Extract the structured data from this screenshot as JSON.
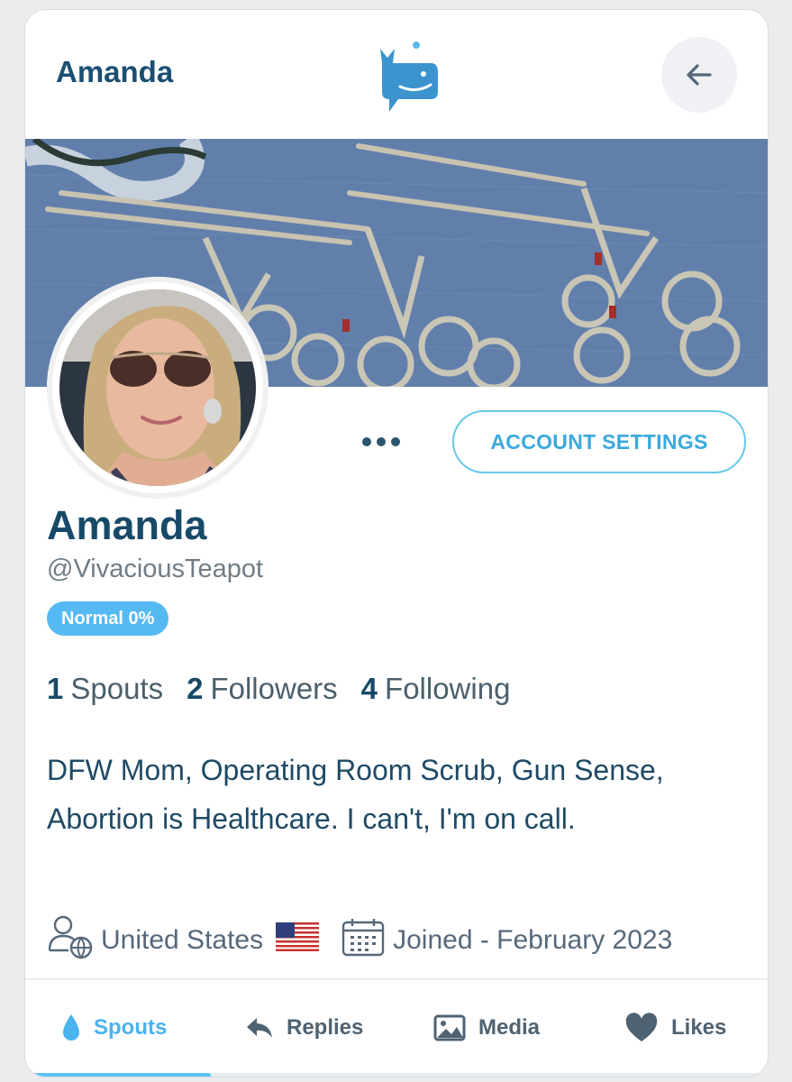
{
  "header": {
    "title": "Amanda",
    "logo_icon": "whale-icon",
    "back_icon": "arrow-left-icon"
  },
  "banner": {
    "description_icon": "surgical-instruments-image"
  },
  "profile": {
    "display_name": "Amanda",
    "handle": "@VivaciousTeapot",
    "badge": "Normal 0%",
    "account_settings_label": "ACCOUNT SETTINGS",
    "more_icon": "more-horizontal-icon"
  },
  "stats": [
    {
      "count": "1",
      "label": "Spouts"
    },
    {
      "count": "2",
      "label": "Followers"
    },
    {
      "count": "4",
      "label": "Following"
    }
  ],
  "bio": "DFW Mom, Operating Room Scrub, Gun Sense, Abortion is Healthcare. I can't, I'm on call.",
  "meta": {
    "location": "United States",
    "location_icon": "user-globe-icon",
    "flag_icon": "us-flag-icon",
    "calendar_icon": "calendar-icon",
    "joined": "Joined - February 2023"
  },
  "tabs": [
    {
      "label": "Spouts",
      "icon": "droplet-icon",
      "active": true
    },
    {
      "label": "Replies",
      "icon": "reply-icon",
      "active": false
    },
    {
      "label": "Media",
      "icon": "image-icon",
      "active": false
    },
    {
      "label": "Likes",
      "icon": "heart-icon",
      "active": false
    }
  ],
  "colors": {
    "primary": "#174a68",
    "accent": "#4bb3ef",
    "badge": "#55b9f2",
    "button_border": "#67c7ea"
  }
}
